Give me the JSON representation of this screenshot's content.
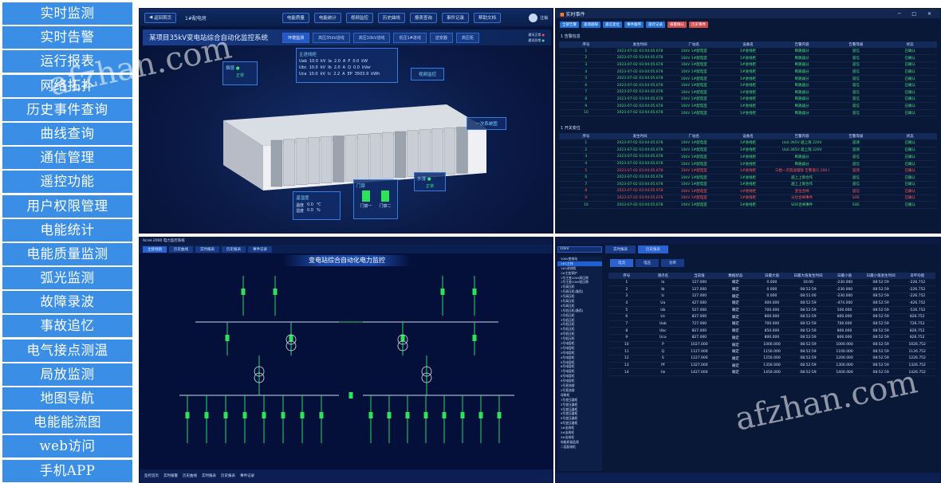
{
  "menu": [
    "实时监测",
    "实时告警",
    "运行报表",
    "网络拓扑",
    "历史事件查询",
    "曲线查询",
    "通信管理",
    "遥控功能",
    "用户权限管理",
    "电能统计",
    "电能质量监测",
    "弧光监测",
    "故障录波",
    "事故追忆",
    "电气接点测温",
    "局放监测",
    "地图导航",
    "电能能流图",
    "web访问",
    "手机APP"
  ],
  "panel1": {
    "back_label": "返回首页",
    "room_label": "1#配电房",
    "toolbar": [
      "电能质量",
      "电能统计",
      "视频监控",
      "历史曲线",
      "报表查询",
      "事件记录",
      "帮助文档"
    ],
    "user": "注销",
    "title": "某项目35kV变电站综合自动化监控系统",
    "tabs": [
      "环境监测",
      "高压35kV进线",
      "高压10kV进线",
      "低压1#进线",
      "逆变器",
      "高压柜"
    ],
    "status_lines": [
      "通讯正常",
      "通讯异常"
    ],
    "smoke": {
      "title": "烟感",
      "status": "正常"
    },
    "measure": {
      "title": "主进线柜",
      "rows": [
        [
          "Uab",
          "10.0",
          "kV",
          "Ia",
          "2.0",
          "A",
          "P",
          "0.0",
          "kW"
        ],
        [
          "Ubc",
          "10.0",
          "kV",
          "Ib",
          "2.0",
          "A",
          "Q",
          "0.0",
          "kVar"
        ],
        [
          "Uca",
          "10.0",
          "kV",
          "Ic",
          "2.2",
          "A",
          "EP",
          "3503.9",
          "kWh"
        ]
      ]
    },
    "video_label": "视频监控",
    "diagram_label": "一次系统图",
    "temp": {
      "title": "温湿度",
      "temp_label": "温度",
      "temp_val": "0.0",
      "temp_unit": "℃",
      "hum_label": "湿度",
      "hum_val": "0.0",
      "hum_unit": "%"
    },
    "door": {
      "title": "门禁",
      "door1": "门禁一",
      "door2": "门禁二"
    },
    "water": {
      "title": "水浸",
      "status": "正常"
    }
  },
  "panel2": {
    "title": "实时事件",
    "section1": "1 告警信息",
    "section2": "1 开关变位",
    "headers": [
      "序号",
      "发生时间",
      "厂站名",
      "设备名",
      "告警内容",
      "告警等级",
      "状态"
    ],
    "time": "2023-07-02 03:04:05.678",
    "station": "10kV 1#配电室",
    "device": "1#进线柜",
    "rows1_count": 10,
    "rows2": [
      [
        "1",
        "Ua0.365V 越上限 220V",
        "遥测",
        false
      ],
      [
        "2",
        "Ua0.365V 越上限 220V",
        "遥测",
        false
      ],
      [
        "3",
        "断路器分",
        "遥信",
        false
      ],
      [
        "4",
        "断路器分",
        "遥信",
        false
      ],
      [
        "5",
        "三相一次谐波越限 告警值[1,100.00,00]",
        "遥测",
        true
      ],
      [
        "6",
        "越上上限合作",
        "遥信",
        false
      ],
      [
        "7",
        "越上上限合作",
        "遥信",
        false
      ],
      [
        "8",
        "变位合闸",
        "遥信",
        true
      ],
      [
        "9",
        "分位合闸事件",
        "SOE",
        true
      ],
      [
        "10",
        "SOE合闸事件",
        "SOE",
        false
      ]
    ],
    "alarm_content": "断路器分",
    "level": "遥信",
    "state": "已确认"
  },
  "panel3": {
    "window_title": "Acrel-2000 电力监控系统",
    "tabs": [
      "主接线图",
      "历史曲线",
      "实时报表",
      "历史报表",
      "事件记录"
    ],
    "banner": "变电站综合自动化电力监控",
    "bottom_tabs": [
      "监控首页",
      "实时报警",
      "历史曲线",
      "实时报表",
      "历史报表",
      "事件记录"
    ]
  },
  "panel4": {
    "selector": "10kV",
    "tabs": [
      "实时报表",
      "历史报表"
    ],
    "subtabs": [
      "电流",
      "电压",
      "功率"
    ],
    "tree": [
      "10kV变电站",
      "1#1主线",
      "1#1进线柜",
      "1#主变保护",
      "1号主变10kV高压侧",
      "1号主变10kV低压侧",
      "1号高压柜",
      "1号高压柜(备用)",
      "2号高压柜",
      "3号高压柜",
      "4号高压柜",
      "1号低压柜(备用)",
      "2号低压柜",
      "3号低压柜",
      "4号低压柜",
      "5号低压柜",
      "6号低压柜",
      "7号低压柜",
      "1号电容柜",
      "2号电容柜",
      "3号电容柜",
      "4号电容柜",
      "5号电容柜",
      "6号电容柜",
      "7号电容柜",
      "8号电容柜",
      "9号电容柜",
      "1号直流屏",
      "2号直流屏",
      "母联柜",
      "1号变压器柜",
      "2号变压器柜",
      "3号变压器柜",
      "4号变压器柜",
      "5号变压器柜",
      "6号变压器柜",
      "1#出线柜",
      "2#出线柜",
      "3#出线柜",
      "电能质量监测",
      "二层配电柜"
    ],
    "headers": [
      "序号",
      "测点名",
      "当前值",
      "数据状态",
      "日最大值",
      "日最大值发生时间",
      "日最小值",
      "日最小值发生时间",
      "日平均值"
    ],
    "rows": [
      [
        "1",
        "Ia",
        "127.000",
        "0.000",
        "16:00",
        "-230.000",
        "08:52:59",
        "-226.752"
      ],
      [
        "2",
        "Ib",
        "127.000",
        "0.000",
        "08:52:59",
        "-230.000",
        "08:52:59",
        "-226.752"
      ],
      [
        "3",
        "Ic",
        "127.000",
        "0.000",
        "08:51:00",
        "-230.000",
        "08:52:59",
        "-226.752"
      ],
      [
        "4",
        "Ua",
        "427.000",
        "400.000",
        "08:52:59",
        "-474.000",
        "08:52:59",
        "-426.752"
      ],
      [
        "5",
        "Ub",
        "527.000",
        "700.000",
        "08:52:59",
        "500.000",
        "08:52:59",
        "-526.752"
      ],
      [
        "6",
        "Uc",
        "827.000",
        "800.000",
        "08:52:59",
        "800.000",
        "08:52:59",
        "826.752"
      ],
      [
        "7",
        "Uab",
        "727.000",
        "700.000",
        "08:52:59",
        "700.000",
        "08:52:59",
        "726.752"
      ],
      [
        "8",
        "Ubc",
        "827.000",
        "850.000",
        "08:52:59",
        "800.000",
        "08:52:59",
        "826.752"
      ],
      [
        "9",
        "Uca",
        "827.000",
        "800.000",
        "08:52:59",
        "800.000",
        "08:52:59",
        "826.752"
      ],
      [
        "10",
        "P",
        "1027.000",
        "1000.000",
        "08:52:59",
        "1000.000",
        "08:52:59",
        "1026.752"
      ],
      [
        "11",
        "Q",
        "1127.000",
        "1150.000",
        "08:52:59",
        "1100.000",
        "08:52:59",
        "1126.752"
      ],
      [
        "12",
        "S",
        "1227.000",
        "1250.000",
        "08:52:59",
        "1200.000",
        "08:52:59",
        "1226.752"
      ],
      [
        "13",
        "Pf",
        "1327.000",
        "1350.000",
        "08:52:59",
        "1300.000",
        "08:52:59",
        "1326.752"
      ],
      [
        "14",
        "Hz",
        "1427.000",
        "1450.000",
        "08:52:59",
        "1400.000",
        "08:52:59",
        "1426.752"
      ]
    ],
    "state": "确定"
  },
  "watermark": "afzhan.com",
  "colors": {
    "menu": "#3a8ee6",
    "green": "#44e07a",
    "red": "#ff5a5a"
  }
}
